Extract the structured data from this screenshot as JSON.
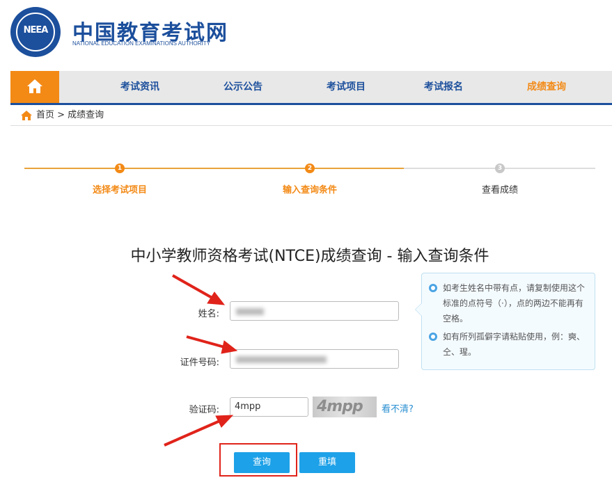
{
  "header": {
    "logo_text": "NEEA",
    "brand_name": "中国教育考试网",
    "brand_sub": "NATIONAL EDUCATION EXAMINATIONS AUTHORITY"
  },
  "nav": {
    "items": [
      {
        "label": "考试资讯"
      },
      {
        "label": "公示公告"
      },
      {
        "label": "考试项目"
      },
      {
        "label": "考试报名"
      },
      {
        "label": "成绩查询"
      }
    ]
  },
  "breadcrumb": {
    "text": "首页 > 成绩查询"
  },
  "steps": [
    {
      "num": "1",
      "label": "选择考试项目"
    },
    {
      "num": "2",
      "label": "输入查询条件"
    },
    {
      "num": "3",
      "label": "查看成绩"
    }
  ],
  "page_title": "中小学教师资格考试(NTCE)成绩查询 - 输入查询条件",
  "form": {
    "name_label": "姓名:",
    "id_label": "证件号码:",
    "captcha_label": "验证码:",
    "captcha_value": "4mpp",
    "captcha_image_text": "4mpp",
    "captcha_refresh": "看不清?"
  },
  "tips": [
    "如考生姓名中带有点，请复制使用这个标准的点符号（·），点的两边不能再有空格。",
    "如有所列孤僻字请粘贴使用，例：奭、仝、瑆。"
  ],
  "buttons": {
    "submit": "查询",
    "reset": "重填"
  },
  "colors": {
    "brand_blue": "#1c4f9c",
    "accent_orange": "#f38a16",
    "button_blue": "#1da1e8",
    "annotation_red": "#e0231a"
  }
}
